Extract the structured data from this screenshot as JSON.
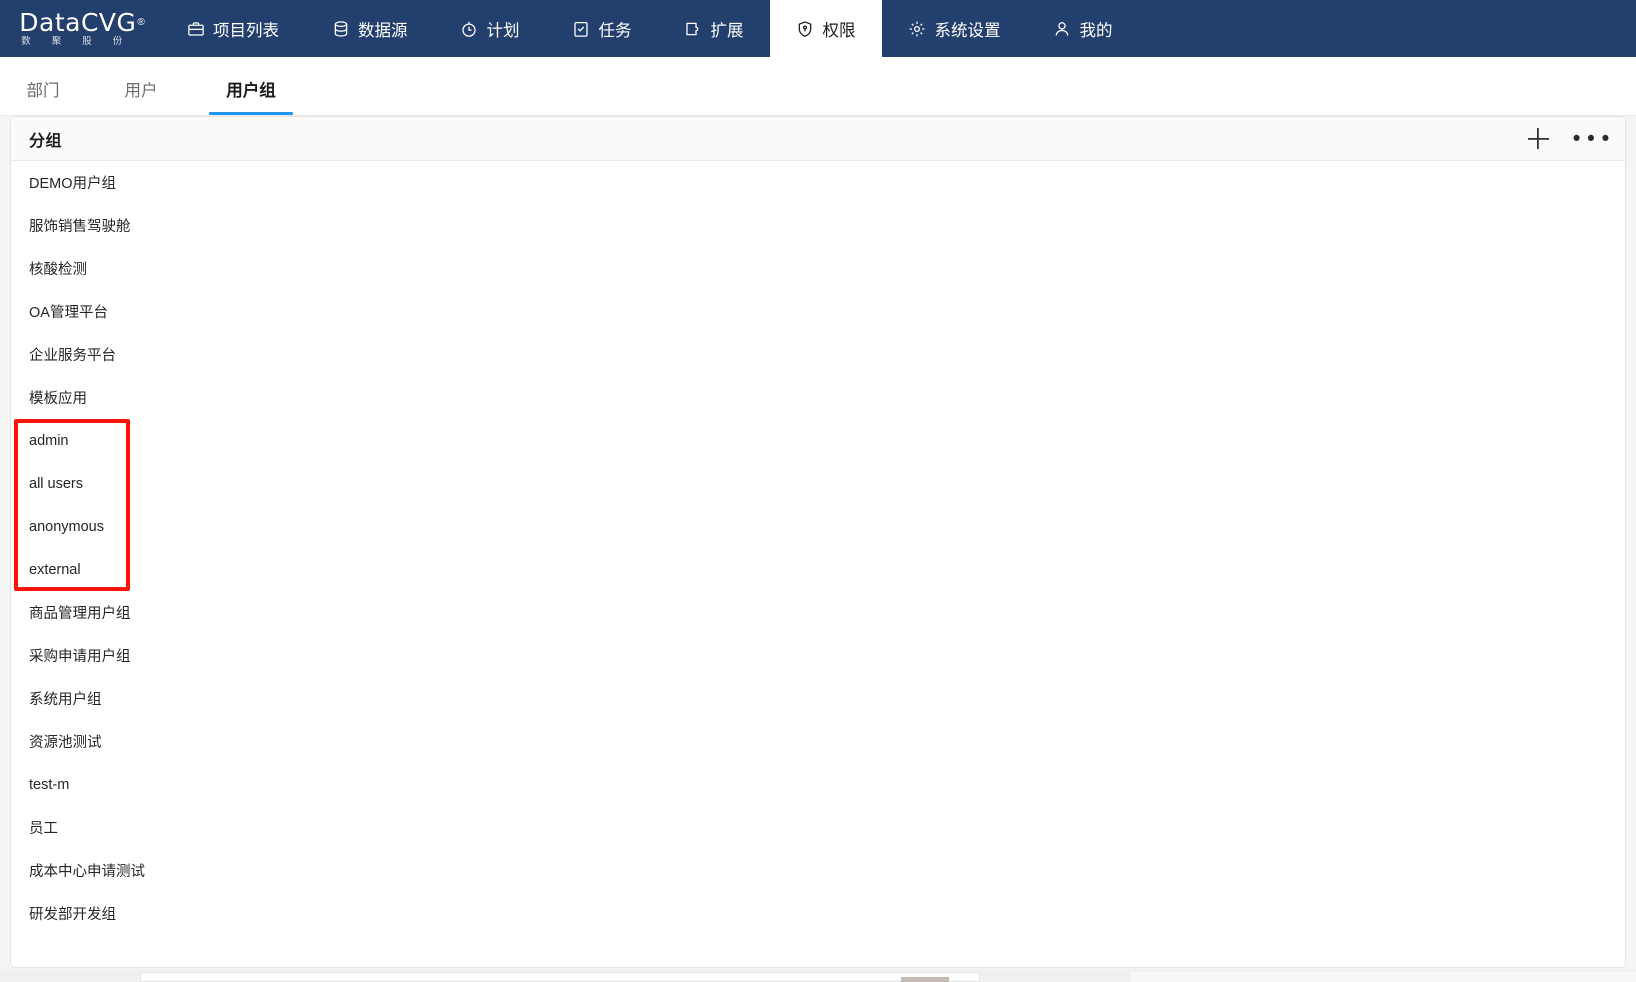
{
  "brand": {
    "name_main": "DataCVG",
    "registered_mark": "®",
    "sub_chars": [
      "数",
      "聚",
      "股",
      "份"
    ]
  },
  "topnav": {
    "items": [
      {
        "label": "项目列表",
        "icon": "briefcase-icon",
        "active": false
      },
      {
        "label": "数据源",
        "icon": "database-icon",
        "active": false
      },
      {
        "label": "计划",
        "icon": "timer-icon",
        "active": false
      },
      {
        "label": "任务",
        "icon": "clipboard-check-icon",
        "active": false
      },
      {
        "label": "扩展",
        "icon": "puzzle-icon",
        "active": false
      },
      {
        "label": "权限",
        "icon": "shield-key-icon",
        "active": true
      },
      {
        "label": "系统设置",
        "icon": "gear-icon",
        "active": false
      },
      {
        "label": "我的",
        "icon": "user-icon",
        "active": false
      }
    ]
  },
  "subtabs": {
    "items": [
      {
        "label": "部门",
        "active": false
      },
      {
        "label": "用户",
        "active": false
      },
      {
        "label": "用户组",
        "active": true
      }
    ]
  },
  "panel": {
    "title": "分组",
    "actions": {
      "add_label": "+",
      "more_label": "•••"
    }
  },
  "groups": [
    {
      "label": "DEMO用户组",
      "highlighted": false
    },
    {
      "label": "服饰销售驾驶舱",
      "highlighted": false
    },
    {
      "label": "核酸检测",
      "highlighted": false
    },
    {
      "label": "OA管理平台",
      "highlighted": false
    },
    {
      "label": "企业服务平台",
      "highlighted": false
    },
    {
      "label": "模板应用",
      "highlighted": false
    },
    {
      "label": "admin",
      "highlighted": true
    },
    {
      "label": "all users",
      "highlighted": true
    },
    {
      "label": "anonymous",
      "highlighted": true
    },
    {
      "label": "external",
      "highlighted": true
    },
    {
      "label": "商品管理用户组",
      "highlighted": false
    },
    {
      "label": "采购申请用户组",
      "highlighted": false
    },
    {
      "label": "系统用户组",
      "highlighted": false
    },
    {
      "label": "资源池测试",
      "highlighted": false
    },
    {
      "label": "test-m",
      "highlighted": false
    },
    {
      "label": "员工",
      "highlighted": false
    },
    {
      "label": "成本中心申请测试",
      "highlighted": false
    },
    {
      "label": "研发部开发组",
      "highlighted": false
    }
  ],
  "annotation": {
    "type": "red-rectangle-highlight",
    "color": "#fc1405",
    "covers_items": [
      "admin",
      "all users",
      "anonymous",
      "external"
    ]
  },
  "colors": {
    "nav_background": "#233f6d",
    "active_tab_underline": "#2196f3",
    "panel_header_background": "#fafafa",
    "text_primary": "#262626",
    "annotation_red": "#fc1405"
  }
}
